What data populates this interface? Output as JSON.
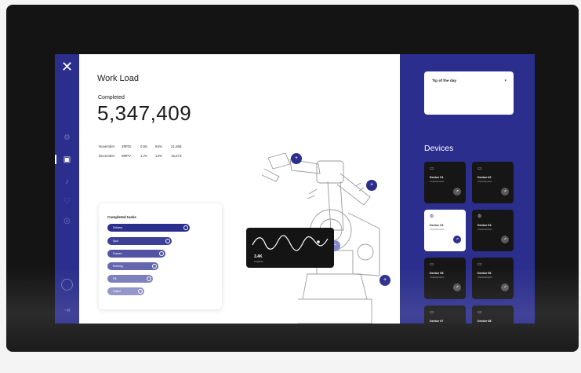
{
  "app": {
    "close_glyph": "✕",
    "workload_title": "Work Load",
    "completed_label": "Completed",
    "completed_value": "5,347,409"
  },
  "sidebar": {
    "icons": [
      "settings-icon",
      "dashboard-icon",
      "notifications-icon",
      "favorites-icon",
      "location-icon",
      "logout-icon"
    ]
  },
  "stats": {
    "headers": [
      "",
      "",
      "",
      "",
      "",
      ""
    ],
    "rows": [
      [
        "November",
        "39PGI",
        "0.56",
        "84%",
        "21,568",
        ""
      ],
      [
        "December",
        "M0PV",
        "1.70",
        "14%",
        "16,273",
        ""
      ]
    ]
  },
  "tasks": {
    "title": "Completed tasks",
    "items": [
      {
        "label": "Delivery",
        "progress": 1.0
      },
      {
        "label": "Spot",
        "progress": 0.78
      },
      {
        "label": "Frames",
        "progress": 0.7
      },
      {
        "label": "Running",
        "progress": 0.62
      },
      {
        "label": "Fill",
        "progress": 0.55
      },
      {
        "label": "Output",
        "progress": 0.45
      }
    ]
  },
  "graph": {
    "value": "3.4K",
    "label": "Capacity"
  },
  "tip": {
    "title": "Tip of the day",
    "text": ""
  },
  "devices": {
    "title": "Devices",
    "items": [
      {
        "name": "Device 01",
        "sub": "Characteristics",
        "selected": false
      },
      {
        "name": "Device 02",
        "sub": "Characteristics",
        "selected": false
      },
      {
        "name": "Device 03",
        "sub": "Characteristics",
        "selected": true
      },
      {
        "name": "Device 04",
        "sub": "Characteristics",
        "selected": false
      },
      {
        "name": "Device 05",
        "sub": "Characteristics",
        "selected": false
      },
      {
        "name": "Device 06",
        "sub": "Characteristics",
        "selected": false
      },
      {
        "name": "Device 07",
        "sub": "Characteristics",
        "selected": false
      },
      {
        "name": "Device 08",
        "sub": "Characteristics",
        "selected": false
      }
    ]
  },
  "colors": {
    "brand": "#2b2e8c",
    "brand_light": "#8588c9",
    "dark_card": "#161616"
  }
}
